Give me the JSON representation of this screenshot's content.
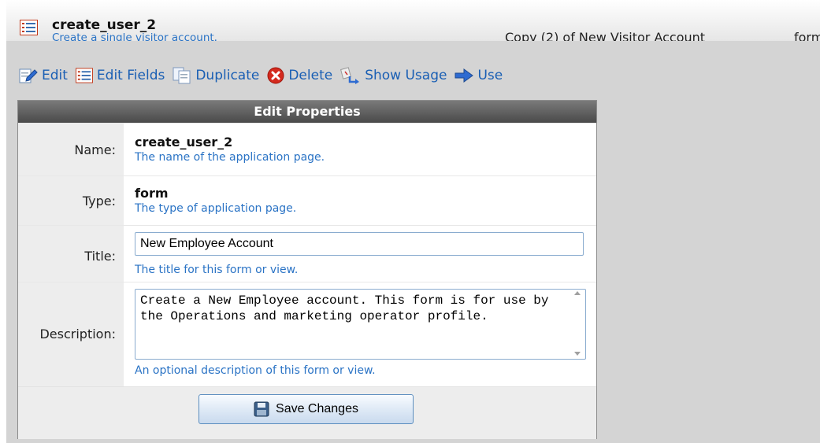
{
  "header": {
    "name": "create_user_2",
    "description": "Create a single visitor account.",
    "page_title": "Copy (2) of New Visitor Account",
    "page_type": "form"
  },
  "toolbar": {
    "edit": "Edit",
    "edit_fields": "Edit Fields",
    "duplicate": "Duplicate",
    "delete": "Delete",
    "show_usage": "Show Usage",
    "use": "Use"
  },
  "panel": {
    "heading": "Edit Properties",
    "name": {
      "label": "Name:",
      "value": "create_user_2",
      "help": "The name of the application page."
    },
    "type": {
      "label": "Type:",
      "value": "form",
      "help": "The type of application page."
    },
    "title": {
      "label": "Title:",
      "value": "New Employee Account",
      "help": "The title for this form or view."
    },
    "description": {
      "label": "Description:",
      "value": "Create a New Employee account. This form is for use by the Operations and marketing operator profile.",
      "help": "An optional description of this form or view."
    },
    "save_label": "Save Changes"
  },
  "colors": {
    "link": "#1a5fb4",
    "help_text": "#2a73c5",
    "panel_header": "#5a5a5a",
    "background": "#d4d4d4"
  }
}
